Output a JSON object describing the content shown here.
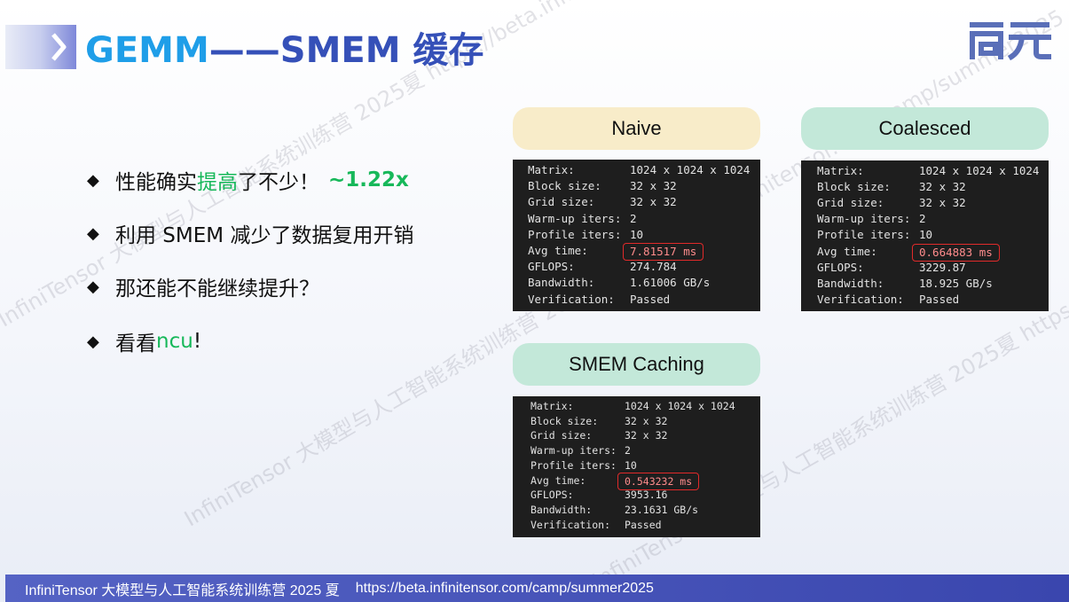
{
  "title": {
    "part1": "GEMM",
    "dash": "——",
    "part2": "SMEM 缓存"
  },
  "logo": {
    "text": "启元"
  },
  "bullets": [
    {
      "pre": "性能确实",
      "hl": "提高",
      "post": "了不少！",
      "extra": "~1.22x"
    },
    {
      "pre": "利用 SMEM 减少了数据复用开销",
      "hl": "",
      "post": "",
      "extra": ""
    },
    {
      "pre": "那还能不能继续提升？",
      "hl": "",
      "post": "",
      "extra": ""
    },
    {
      "pre": "看看 ",
      "hl": "ncu",
      "post": "!",
      "extra": ""
    }
  ],
  "panels": [
    {
      "label": "Naive",
      "rows": [
        [
          "Matrix:",
          "1024 x 1024 x 1024"
        ],
        [
          "Block size:",
          "32 x 32"
        ],
        [
          "Grid size:",
          "32 x 32"
        ],
        [
          "Warm-up iters:",
          "2"
        ],
        [
          "Profile iters:",
          "10"
        ],
        [
          "Avg time:",
          "7.81517 ms"
        ],
        [
          "GFLOPS:",
          "274.784"
        ],
        [
          "Bandwidth:",
          "1.61006 GB/s"
        ],
        [
          "Verification:",
          "Passed"
        ]
      ]
    },
    {
      "label": "Coalesced",
      "rows": [
        [
          "Matrix:",
          "1024 x 1024 x 1024"
        ],
        [
          "Block size:",
          "32 x 32"
        ],
        [
          "Grid size:",
          "32 x 32"
        ],
        [
          "Warm-up iters:",
          "2"
        ],
        [
          "Profile iters:",
          "10"
        ],
        [
          "Avg time:",
          "0.664883 ms"
        ],
        [
          "GFLOPS:",
          "3229.87"
        ],
        [
          "Bandwidth:",
          "18.925 GB/s"
        ],
        [
          "Verification:",
          "Passed"
        ]
      ]
    },
    {
      "label": "SMEM Caching",
      "rows": [
        [
          "Matrix:",
          "1024 x 1024 x 1024"
        ],
        [
          "Block size:",
          "32 x 32"
        ],
        [
          "Grid size:",
          "32 x 32"
        ],
        [
          "Warm-up iters:",
          "2"
        ],
        [
          "Profile iters:",
          "10"
        ],
        [
          "Avg time:",
          "0.543232 ms"
        ],
        [
          "GFLOPS:",
          "3953.16"
        ],
        [
          "Bandwidth:",
          "23.1631 GB/s"
        ],
        [
          "Verification:",
          "Passed"
        ]
      ]
    }
  ],
  "footer": {
    "camp": "InfiniTensor 大模型与人工智能系统训练营 2025 夏",
    "url": "https://beta.infinitensor.com/camp/summer2025"
  },
  "watermark": "InfiniTensor 大模型与人工智能系统训练营 2025夏 https://beta.infinitensor.com/camp/summer2025",
  "colors": {
    "title_light": "#1f9ee8",
    "title_dark": "#3550b8",
    "highlight_green": "#17b85a",
    "footer_bg": "#3a46ae",
    "terminal_bg": "#1e1e1e",
    "box_red": "#e02a2a"
  }
}
